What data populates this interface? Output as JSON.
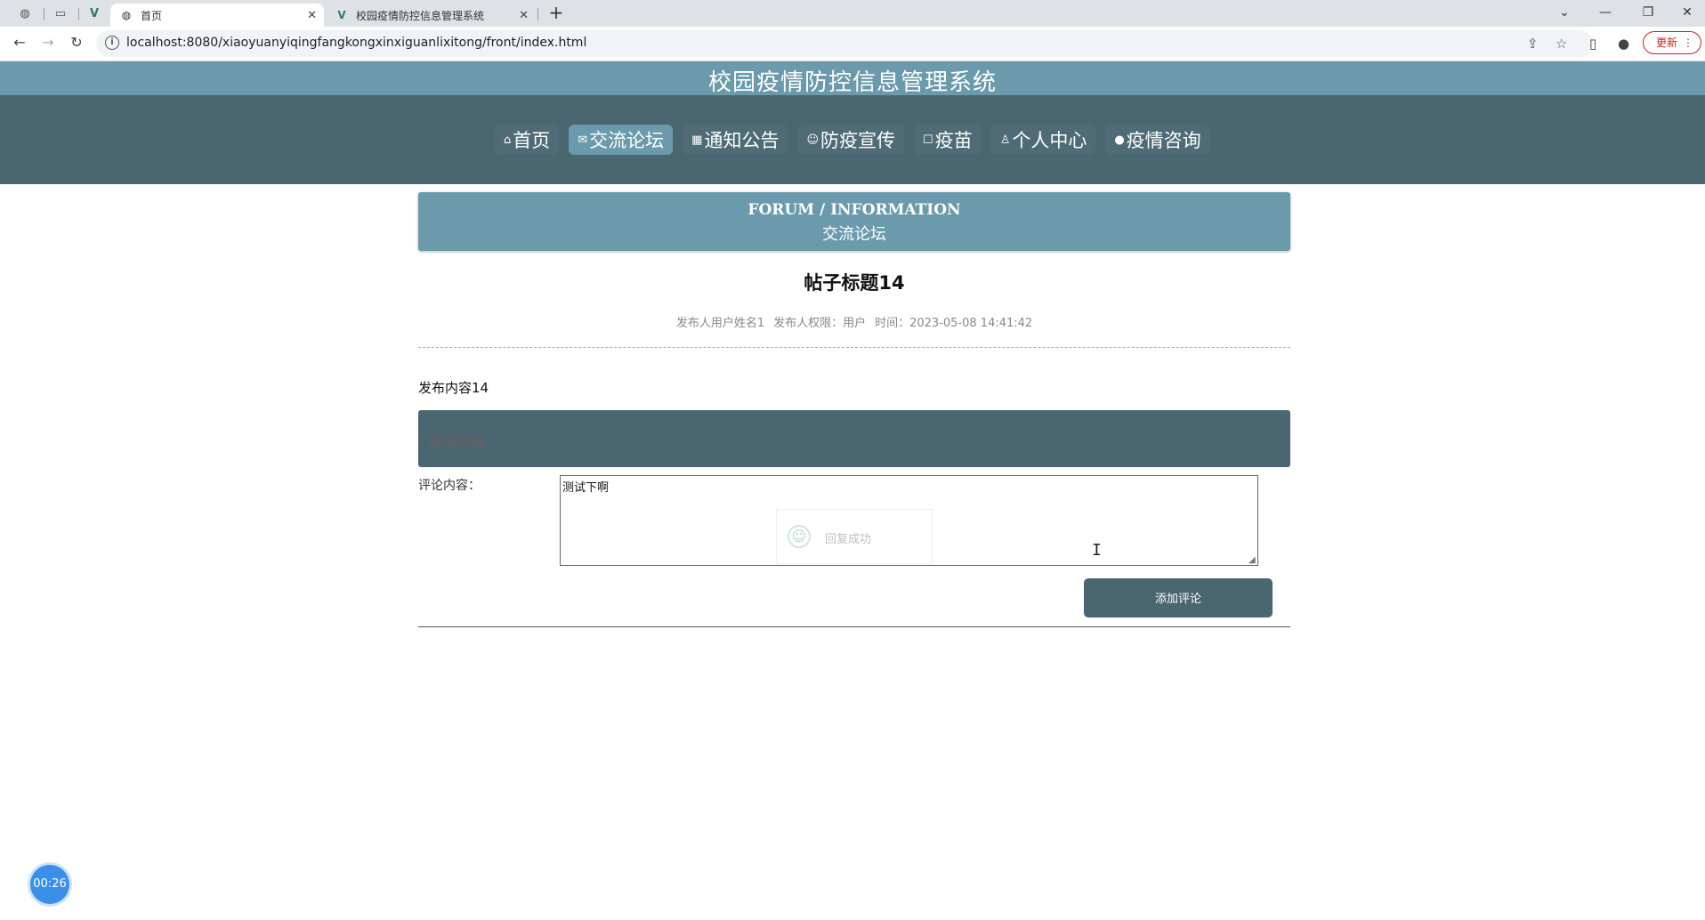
{
  "browser": {
    "tabs": [
      {
        "title": "首页",
        "active": true
      },
      {
        "title": "校园疫情防控信息管理系统",
        "active": false
      }
    ],
    "url": "localhost:8080/xiaoyuanyiqingfangkongxinxiguanlixitong/front/index.html",
    "update_label": "更新"
  },
  "site": {
    "title": "校园疫情防控信息管理系统",
    "nav": [
      {
        "label": "首页",
        "icon": "home-icon",
        "glyph": "⌂",
        "active": false
      },
      {
        "label": "交流论坛",
        "icon": "mail-icon",
        "glyph": "✉",
        "active": true
      },
      {
        "label": "通知公告",
        "icon": "grid-icon",
        "glyph": "▦",
        "active": false
      },
      {
        "label": "防疫宣传",
        "icon": "smile-icon",
        "glyph": "☺",
        "active": false
      },
      {
        "label": "疫苗",
        "icon": "square-icon",
        "glyph": "☐",
        "active": false
      },
      {
        "label": "个人中心",
        "icon": "user-icon",
        "glyph": "♙",
        "active": false
      },
      {
        "label": "疫情咨询",
        "icon": "chat-icon",
        "glyph": "●",
        "active": false
      }
    ]
  },
  "section": {
    "title_en": "FORUM / INFORMATION",
    "title_cn": "交流论坛"
  },
  "post": {
    "title": "帖子标题14",
    "author": "发布人用户姓名1",
    "role": "发布人权限：用户",
    "time": "时间：2023-05-08 14:41:42",
    "content": "发布内容14"
  },
  "comments": {
    "header": "评论列表",
    "label": "评论内容：",
    "input_value": "测试下啊",
    "toast": "回复成功",
    "submit_label": "添加评论"
  },
  "timer": "00:26"
}
